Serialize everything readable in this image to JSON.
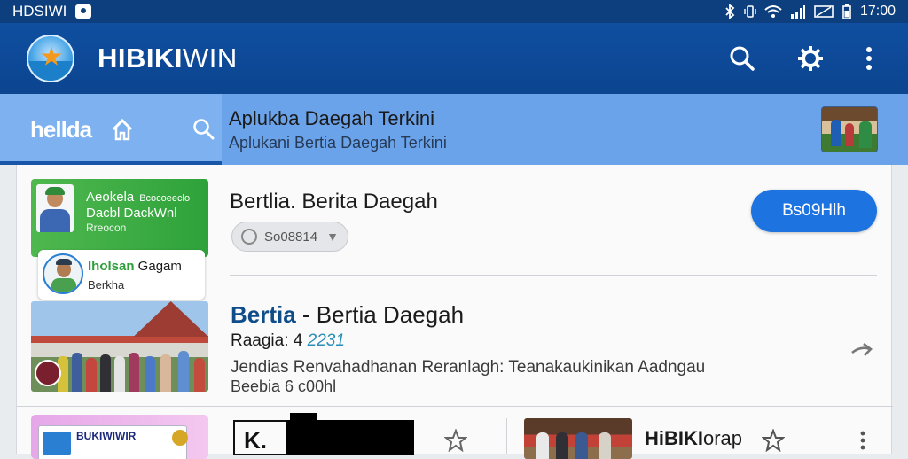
{
  "status_bar": {
    "left_label": "HDSIWI",
    "time": "17:00"
  },
  "app_bar": {
    "title_bold": "HIBIKI",
    "title_light": "WIN",
    "icons": [
      "search-icon",
      "settings-icon",
      "more-vert-icon"
    ]
  },
  "tab_bar": {
    "logo_text": "hellda",
    "title": "Aplukba Daegah Terkini",
    "subtitle": "Aplukani Bertia Daegah  Terkini"
  },
  "card1": {
    "banner_line1": "Aeokela",
    "banner_line1_small": "Bcocoeeclo",
    "banner_line2": "Dacbl DackWnl",
    "banner_line3": "Rreocon",
    "tag_name_green": "Iholsan",
    "tag_name_rest": " Gagam",
    "tag_sub": "Berkha",
    "title": "Bertlia. Berita Daegah",
    "chip_label": "So08814",
    "button_label": "Bs09Hlh"
  },
  "card2": {
    "title_bold": "Bertia",
    "title_rest": " - Bertia Daegah",
    "meta_label": "Raagia: 4 ",
    "meta_number": "2231",
    "description": "Jendias Renvahadhanan Reranlagh: Teanakaukinikan Aadngau",
    "description2": "Beebia 6 c00hl"
  },
  "card3": {
    "promo_text": "BUKIWIWIR",
    "logo_letters": "K.",
    "title_bold": "HiBIKI",
    "title_rest": "orap"
  },
  "colors": {
    "status_bar": "#0d3f7e",
    "app_bar": "#0f4ea0",
    "tab_bar": "#6aa3ea",
    "button": "#1d73e0",
    "accent_green": "#2ea23a"
  }
}
